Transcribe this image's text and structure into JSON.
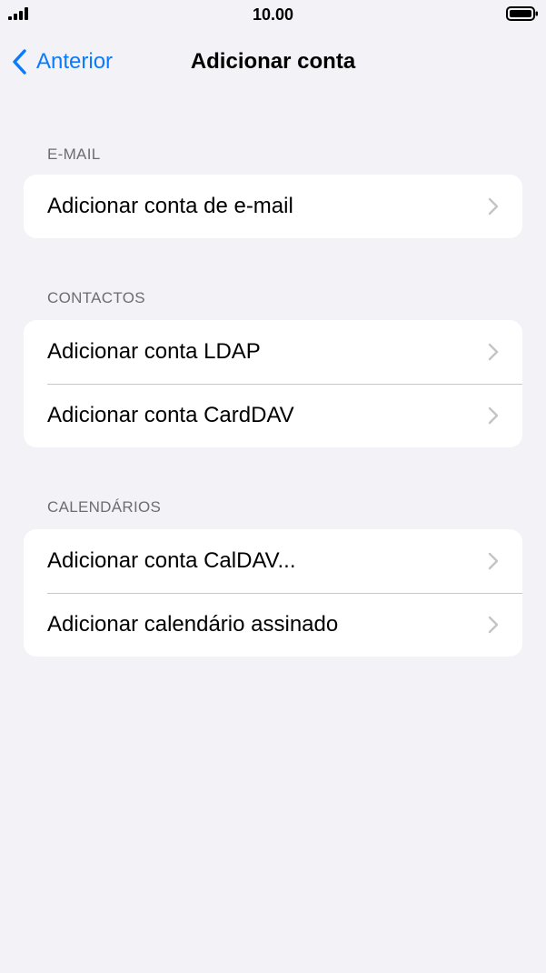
{
  "status_bar": {
    "time": "10.00",
    "signal_icon": "cellular-signal-icon",
    "battery_icon": "battery-icon"
  },
  "nav": {
    "back_label": "Anterior",
    "title": "Adicionar conta"
  },
  "sections": [
    {
      "header": "E-MAIL",
      "items": [
        {
          "label": "Adicionar conta de e-mail"
        }
      ]
    },
    {
      "header": "CONTACTOS",
      "items": [
        {
          "label": "Adicionar conta LDAP"
        },
        {
          "label": "Adicionar conta CardDAV"
        }
      ]
    },
    {
      "header": "CALENDÁRIOS",
      "items": [
        {
          "label": "Adicionar conta CalDAV..."
        },
        {
          "label": "Adicionar calendário assinado"
        }
      ]
    }
  ],
  "colors": {
    "accent": "#0a7aff",
    "background": "#f2f2f7",
    "card": "#ffffff",
    "section_header": "#6d6d72",
    "separator": "#c8c7cc",
    "chevron": "#c4c4c7"
  }
}
